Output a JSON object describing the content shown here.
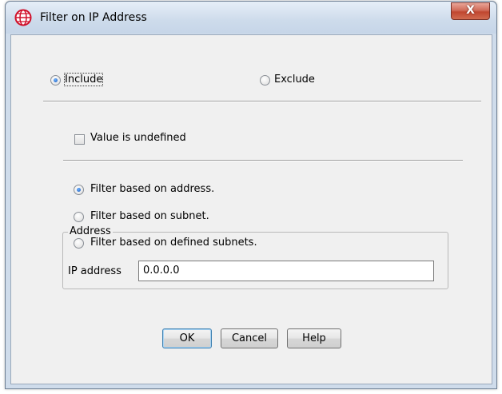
{
  "window": {
    "title": "Filter on IP Address",
    "close_label": "X"
  },
  "mode": {
    "include_label": "Include",
    "exclude_label": "Exclude",
    "selected": "Include"
  },
  "undefined_checkbox": {
    "label": "Value is undefined",
    "checked": false
  },
  "filter_type": {
    "options": [
      "Filter based on address.",
      "Filter based on subnet.",
      "Filter based on defined subnets."
    ],
    "selected": "Filter based on address."
  },
  "address_group": {
    "legend": "Address",
    "ip_label": "IP address",
    "ip_value": "0.0.0.0"
  },
  "buttons": {
    "ok": "OK",
    "cancel": "Cancel",
    "help": "Help"
  }
}
